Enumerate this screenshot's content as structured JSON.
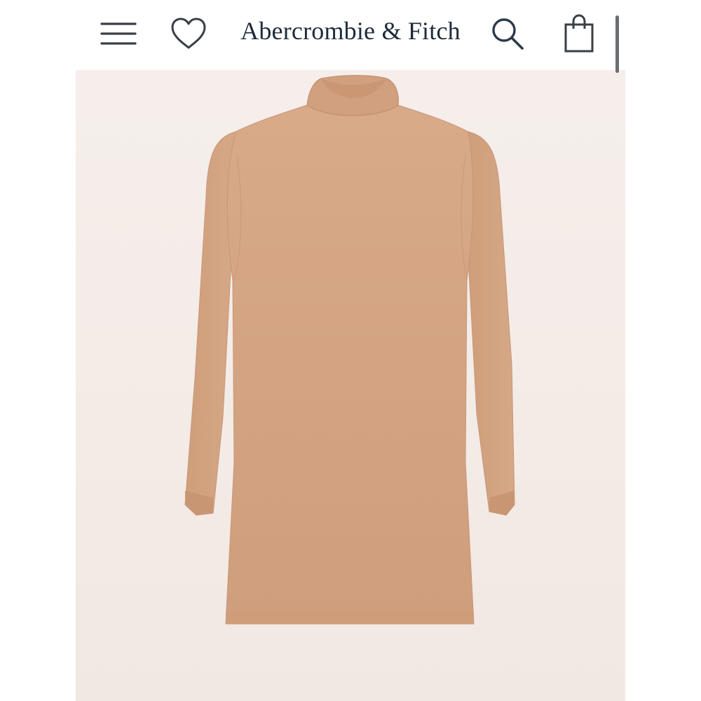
{
  "header": {
    "brand": "Abercrombie & Fitch",
    "icons": {
      "menu": "hamburger-menu-icon",
      "favorites": "heart-icon",
      "search": "search-icon",
      "bag": "shopping-bag-icon"
    }
  },
  "product": {
    "image": "camel mock-neck long-sleeve sweater dress",
    "colors": {
      "fabric": "#d4a482",
      "background": "#f3ece8"
    }
  },
  "colors": {
    "brand_text": "#1f2b3a",
    "icon_stroke": "#3a3f45",
    "scrollbar": "#6b6f72"
  }
}
